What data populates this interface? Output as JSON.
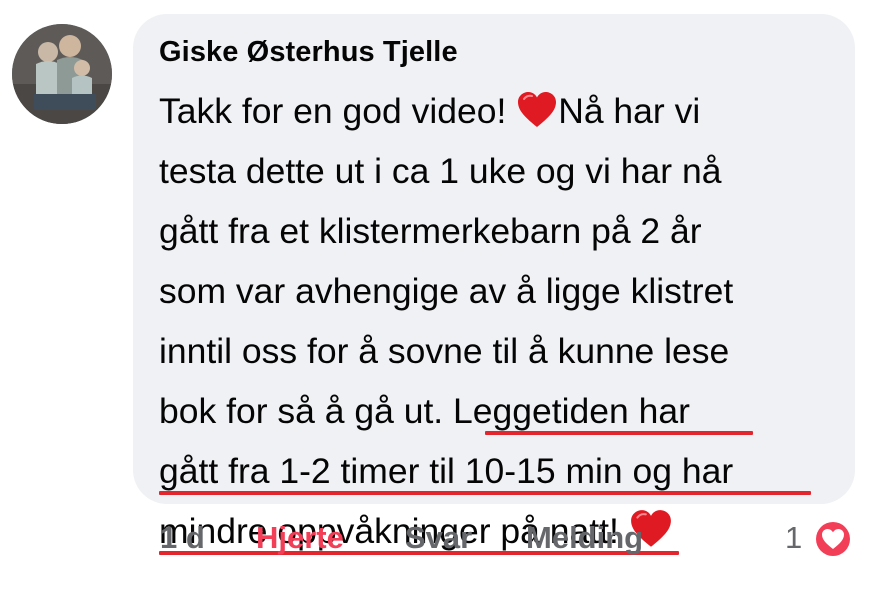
{
  "comment": {
    "author": "Giske Østerhus Tjelle",
    "lines": [
      "Takk for en god video! ",
      "Nå har vi",
      "testa dette ut i ca 1 uke og vi har nå",
      "gått fra et klistermerkebarn på 2 år",
      "som var avhengige av å ligge klistret",
      "inntil oss for å sovne til å kunne lese",
      "bok for så å gå ut. ",
      "Leggetiden har",
      "gått fra 1-2 timer til 10-15 min og har",
      "mindre oppvåkninger på natt! "
    ],
    "emoji": "red-heart-emoji",
    "underline_color": "#e3262e"
  },
  "actions": {
    "time": "1 d",
    "reaction_label": "Hjerte",
    "reply_label": "Svar",
    "message_label": "Melding",
    "reaction_count": "1",
    "reaction_icon": "heart-reaction-icon",
    "reaction_color": "#f33e58"
  },
  "colors": {
    "bubble": "#eff1f4",
    "text": "#050505",
    "muted": "#65676b"
  }
}
